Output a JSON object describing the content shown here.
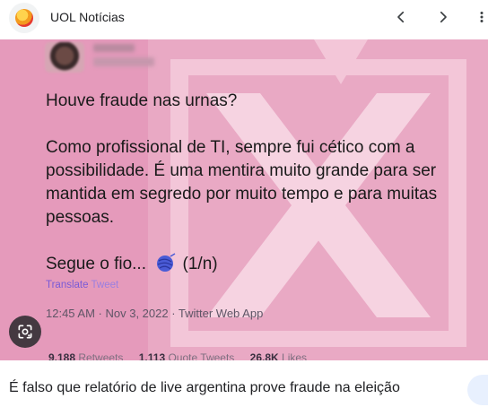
{
  "header": {
    "site_name": "UOL Notícias",
    "favicon_icon": "uol-logo-icon",
    "prev_icon": "chevron-left-icon",
    "next_icon": "chevron-right-icon",
    "more_icon": "more-vert-icon"
  },
  "tweet": {
    "question": "Houve fraude nas urnas?",
    "body": "Como profissional de TI, sempre fui cético com a possibilidade. É uma mentira muito grande para ser mantida em segredo por muito tempo e para muitas pessoas.",
    "thread_prefix": "Segue o fio...",
    "thread_suffix": "(1/n)",
    "translate_a": "Translate",
    "translate_b": "Tweet",
    "timestamp": "12:45 AM · Nov 3, 2022 · Twitter Web App",
    "retweets_count": "9.188",
    "retweets_label": "Retweets",
    "quotes_count": "1.113",
    "quotes_label": "Quote Tweets",
    "likes_count": "26,8K",
    "likes_label": "Likes"
  },
  "lens_icon": "google-lens-icon",
  "caption": "É falso que relatório de live argentina prove fraude na eleição",
  "colors": {
    "image_bg": "#e8a3bf",
    "watermark": "#f4c8da",
    "translate": "#7a5bd6"
  }
}
